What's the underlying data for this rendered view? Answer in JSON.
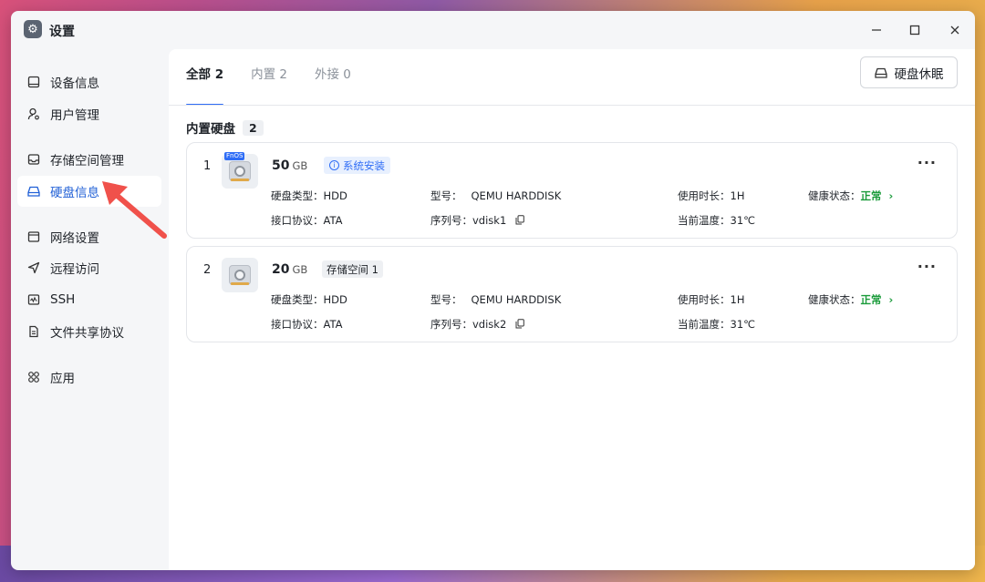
{
  "window": {
    "title": "设置"
  },
  "sidebar": {
    "items": [
      {
        "label": "设备信息",
        "icon": "device-icon"
      },
      {
        "label": "用户管理",
        "icon": "user-icon"
      },
      {
        "label": "存储空间管理",
        "icon": "storage-icon"
      },
      {
        "label": "硬盘信息",
        "icon": "disk-icon",
        "active": true
      },
      {
        "label": "网络设置",
        "icon": "network-icon"
      },
      {
        "label": "远程访问",
        "icon": "remote-icon"
      },
      {
        "label": "SSH",
        "icon": "ssh-icon"
      },
      {
        "label": "文件共享协议",
        "icon": "file-share-icon"
      },
      {
        "label": "应用",
        "icon": "apps-icon"
      }
    ]
  },
  "tabs": [
    {
      "label": "全部 2",
      "active": true
    },
    {
      "label": "内置 2"
    },
    {
      "label": "外接 0"
    }
  ],
  "toolbar": {
    "sleep_label": "硬盘休眠"
  },
  "section": {
    "title": "内置硬盘",
    "count": "2"
  },
  "disks": [
    {
      "index": "1",
      "size": "50",
      "unit": "GB",
      "tag": "系统安装",
      "badge": "FnOS",
      "type_key": "硬盘类型：",
      "type_val": "HDD",
      "model_key": "型号：",
      "model_val": "QEMU HARDDISK",
      "hours_key": "使用时长：",
      "hours_val": "1H",
      "health_key": "健康状态：",
      "health_val": "正常",
      "iface_key": "接口协议：",
      "iface_val": "ATA",
      "serial_key": "序列号：",
      "serial_val": "vdisk1",
      "temp_key": "当前温度：",
      "temp_val": "31℃"
    },
    {
      "index": "2",
      "size": "20",
      "unit": "GB",
      "tag": "存储空间 1",
      "type_key": "硬盘类型：",
      "type_val": "HDD",
      "model_key": "型号：",
      "model_val": "QEMU HARDDISK",
      "hours_key": "使用时长：",
      "hours_val": "1H",
      "health_key": "健康状态：",
      "health_val": "正常",
      "iface_key": "接口协议：",
      "iface_val": "ATA",
      "serial_key": "序列号：",
      "serial_val": "vdisk2",
      "temp_key": "当前温度：",
      "temp_val": "31℃"
    }
  ],
  "colors": {
    "accent": "#2f6df6",
    "ok": "#1a9b3a",
    "arrow": "#f0514b"
  }
}
